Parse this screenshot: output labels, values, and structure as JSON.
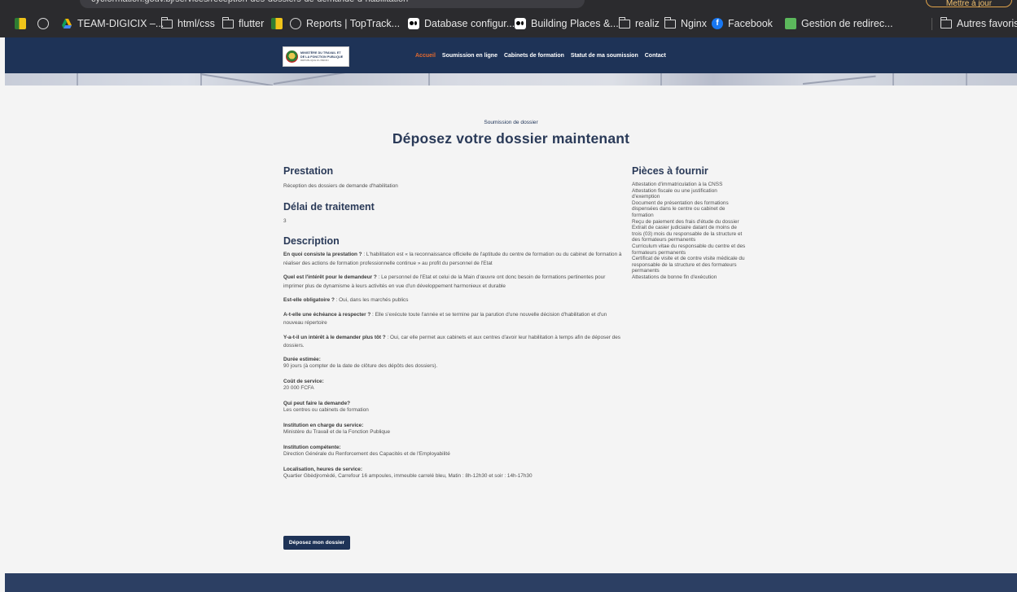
{
  "browser": {
    "url": "cycformation.gouv.bj/services/reception-des-dossiers-de-demande-d-habilitation",
    "update_button": "Mettre à jour",
    "bookmarks": [
      {
        "label": "TEAM-DIGICIX –...",
        "icon": "drive-icon"
      },
      {
        "label": "html/css",
        "icon": "folder-icon"
      },
      {
        "label": "flutter",
        "icon": "folder-icon"
      },
      {
        "label": "Reports | TopTrack...",
        "icon": "github-icon"
      },
      {
        "label": "Database configur...",
        "icon": "medium-icon"
      },
      {
        "label": "Building Places &...",
        "icon": "medium-icon"
      },
      {
        "label": "realiz",
        "icon": "folder-icon"
      },
      {
        "label": "Nginx",
        "icon": "folder-icon"
      },
      {
        "label": "Facebook",
        "icon": "facebook-icon"
      },
      {
        "label": "Gestion de redirec...",
        "icon": "green-square-icon"
      },
      {
        "label": "Autres favoris",
        "icon": "folder-icon"
      }
    ]
  },
  "site": {
    "logo": {
      "line1": "MINISTÈRE DU TRAVAIL ET",
      "line2": "DE LA FONCTION PUBLIQUE",
      "line3": "RÉPUBLIQUE DU BÉNIN"
    },
    "nav": [
      "Accueil",
      "Soumission en ligne",
      "Cabinets de formation",
      "Statut de ma soumission",
      "Contact"
    ],
    "accent_color": "#e2692f",
    "primary_color": "#1e3357"
  },
  "page": {
    "eyebrow": "Soumission de dossier",
    "title": "Déposez votre dossier maintenant",
    "prestation_title": "Prestation",
    "prestation_text": "Réception des dossiers de demande d'habilitation",
    "delai_title": "Délai de traitement",
    "delai_value": "3",
    "description_title": "Description",
    "qa": [
      {
        "q": "En quoi consiste la prestation ?",
        "a": " : L'habilitation est « la reconnaissance officielle de l'aptitude du centre de formation ou du cabinet de formation à réaliser des actions de formation professionnelle continue » au profit du personnel de l'Etat"
      },
      {
        "q": "Quel est l'intérêt pour le demandeur ?",
        "a": " : Le personnel de l'Etat et celui de la Main d'œuvre ont donc besoin de formations pertinentes pour imprimer plus de dynamisme à leurs activités en vue d'un développement harmonieux et durable"
      },
      {
        "q": "Est-elle obligatoire ?",
        "a": " : Oui, dans les marchés publics"
      },
      {
        "q": "A-t-elle une échéance à respecter ?",
        "a": " : Elle s'exécute toute l'année et se termine par la parution d'une nouvelle décision d'habilitation et d'un nouveau répertoire"
      },
      {
        "q": "Y-a-t-il un intérêt à le demander plus tôt ?",
        "a": " : Oui, car elle permet aux cabinets et aux centres d'avoir leur habilitation à temps afin de déposer des dossiers."
      }
    ],
    "details": [
      {
        "label": "Durée estimée:",
        "value": "90 jours (à compter de la date de clôture des dépôts des dossiers)."
      },
      {
        "label": "Coût de service:",
        "value": "20 000 FCFA"
      },
      {
        "label": "Qui peut faire la demande?",
        "value": "Les centres ou cabinets de formation"
      },
      {
        "label": "Institution en charge du service:",
        "value": "Ministère du Travail et de la Fonction Publique"
      },
      {
        "label": "Institution compétente:",
        "value": "Direction Générale du Renforcement des Capacités et de l'Employabilité"
      },
      {
        "label": "Localisation, heures de service:",
        "value": "Quartier Gbèdjromèdé, Carrefour 16 ampoules, immeuble carrelé bleu, Matin : 8h-12h30 et soir : 14h-17h30"
      }
    ],
    "submit_label": "Déposez mon dossier",
    "pieces_title": "Pièces à fournir",
    "pieces": [
      "Attestation d'immatriculation à la CNSS",
      "Attestation fiscale ou une justification d'exemption",
      "Document de présentation des formations dispensées dans le centre ou cabinet de formation",
      "Reçu de paiement des frais d'étude du dossier",
      "Extrait de casier judiciaire datant de moins de trois (03) mois du responsable de la structure et des formateurs permanents",
      "Curriculum vitae du responsable du centre et des formateurs permanents",
      "Certificat de visite et de contre visite médicale du responsable de la structure et des formateurs permanents",
      "Attestations de bonne fin d'exécution"
    ]
  }
}
